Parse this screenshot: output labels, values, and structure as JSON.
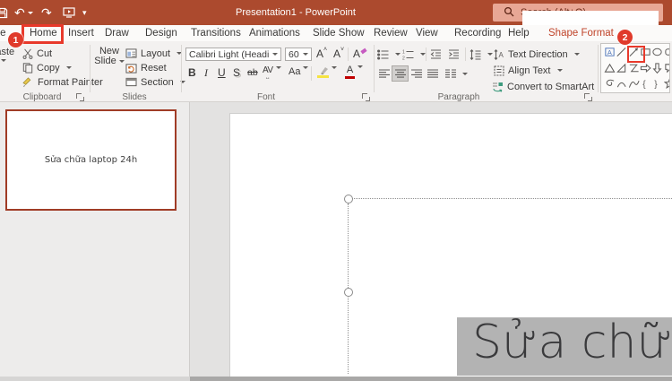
{
  "titlebar": {
    "title": "Presentation1 - PowerPoint",
    "search_placeholder": "Search (Alt+Q)"
  },
  "tabs": {
    "items": [
      {
        "label": "File"
      },
      {
        "label": "Home",
        "annotated": true
      },
      {
        "label": "Insert"
      },
      {
        "label": "Draw"
      },
      {
        "label": "Design"
      },
      {
        "label": "Transitions"
      },
      {
        "label": "Animations"
      },
      {
        "label": "Slide Show"
      },
      {
        "label": "Review"
      },
      {
        "label": "View"
      },
      {
        "label": "Recording"
      },
      {
        "label": "Help"
      },
      {
        "label": "Shape Format",
        "contextual": true
      }
    ]
  },
  "annotations": {
    "step1": "1",
    "step2": "2"
  },
  "ribbon": {
    "clipboard": {
      "label": "Clipboard",
      "paste": "Paste",
      "cut": "Cut",
      "copy": "Copy",
      "format_painter": "Format Painter"
    },
    "slides": {
      "label": "Slides",
      "new_slide_line1": "New",
      "new_slide_line2": "Slide",
      "layout": "Layout",
      "reset": "Reset",
      "section": "Section"
    },
    "font": {
      "label": "Font",
      "font_name": "Calibri Light (Headings)",
      "font_size": "60",
      "grow": "A",
      "shrink": "A",
      "clear": "A",
      "bold": "B",
      "italic": "I",
      "underline": "U",
      "shadow": "S",
      "strikethrough": "ab",
      "char_spacing": "AV",
      "change_case": "Aa",
      "font_color": "A"
    },
    "paragraph": {
      "label": "Paragraph",
      "text_direction": "Text Direction",
      "align_text": "Align Text",
      "convert_smartart": "Convert to SmartArt"
    },
    "shapes": {
      "gallery": [
        "text-box",
        "line",
        "arrow-line",
        "rectangle",
        "oval",
        "rounded-rectangle",
        "triangle",
        "right-triangle",
        "freeform-z",
        "arrow-right",
        "arrow-down",
        "callout",
        "scribble",
        "arc",
        "curve",
        "left-brace",
        "right-brace",
        "star"
      ],
      "highlighted_shape": "rectangle"
    }
  },
  "slide_panel": {
    "thumbnail_text": "Sửa chữa laptop 24h"
  },
  "canvas": {
    "selected_overlay_text": "Sửa chữa"
  },
  "icons": {
    "save": "floppy",
    "undo": "↶",
    "redo": "↷",
    "present": "monitor",
    "qat-more": "▾",
    "search": "magnifier",
    "dropdown": "caret-triangle"
  },
  "colors": {
    "titlebar": "#AC4A2E",
    "accent_red": "#B7472A",
    "annotation_red": "#E8392B",
    "search_bg": "#E8A795",
    "selection_gray": "#B3B3B3",
    "thumbnail_border": "#A03C26"
  }
}
